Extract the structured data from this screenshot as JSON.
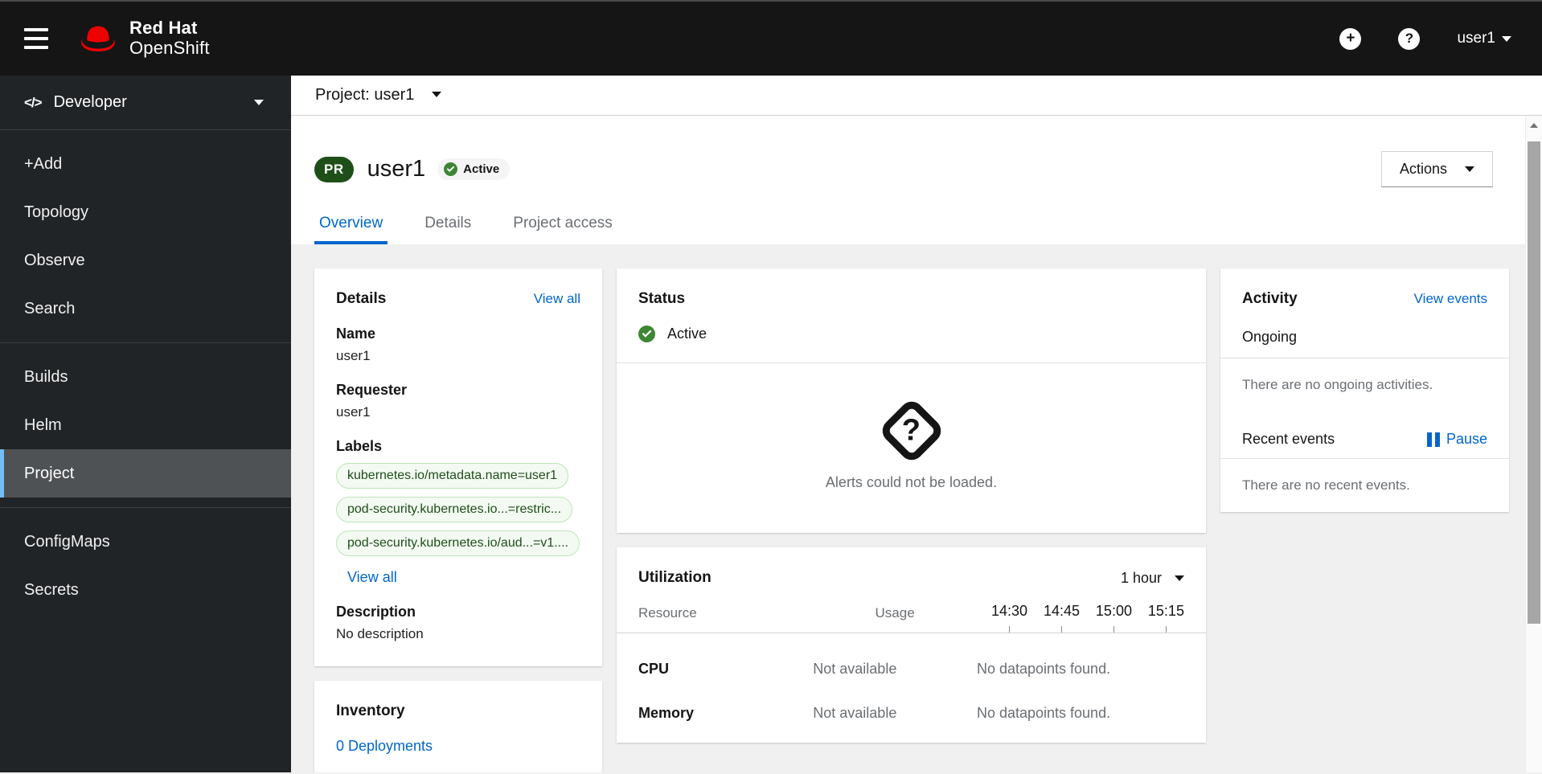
{
  "masthead": {
    "logo_line1": "Red Hat",
    "logo_line2": "OpenShift",
    "username": "user1"
  },
  "sidebar": {
    "perspective": {
      "label": "Developer"
    },
    "groups": [
      {
        "items": [
          {
            "label": "+Add"
          },
          {
            "label": "Topology"
          },
          {
            "label": "Observe"
          },
          {
            "label": "Search"
          }
        ]
      },
      {
        "items": [
          {
            "label": "Builds"
          },
          {
            "label": "Helm"
          },
          {
            "label": "Project"
          }
        ]
      },
      {
        "items": [
          {
            "label": "ConfigMaps"
          },
          {
            "label": "Secrets"
          }
        ]
      }
    ]
  },
  "project_bar": {
    "label": "Project: user1"
  },
  "page": {
    "badge": "PR",
    "title": "user1",
    "status_badge": "Active",
    "actions_label": "Actions",
    "tabs": [
      {
        "label": "Overview"
      },
      {
        "label": "Details"
      },
      {
        "label": "Project access"
      }
    ]
  },
  "details_card": {
    "title": "Details",
    "view_all": "View all",
    "fields": [
      {
        "label": "Name",
        "value": "user1"
      },
      {
        "label": "Requester",
        "value": "user1"
      }
    ],
    "labels_title": "Labels",
    "labels": [
      "kubernetes.io/metadata.name=user1",
      "pod-security.kubernetes.io...=restric...",
      "pod-security.kubernetes.io/aud...=v1...."
    ],
    "labels_view_all": "View all",
    "description_label": "Description",
    "description_value": "No description"
  },
  "inventory_card": {
    "title": "Inventory",
    "deployments_link": "0 Deployments"
  },
  "status_card": {
    "title": "Status",
    "status": "Active",
    "alerts_message": "Alerts could not be loaded."
  },
  "utilization_card": {
    "title": "Utilization",
    "duration": "1 hour",
    "resource_header": "Resource",
    "usage_header": "Usage",
    "times": [
      "14:30",
      "14:45",
      "15:00",
      "15:15"
    ],
    "rows": [
      {
        "resource": "CPU",
        "usage": "Not available",
        "graph": "No datapoints found."
      },
      {
        "resource": "Memory",
        "usage": "Not available",
        "graph": "No datapoints found."
      }
    ]
  },
  "activity_card": {
    "title": "Activity",
    "view_events": "View events",
    "ongoing_title": "Ongoing",
    "ongoing_empty": "There are no ongoing activities.",
    "recent_title": "Recent events",
    "pause_label": "Pause",
    "recent_empty": "There are no recent events."
  },
  "colors": {
    "accent": "#0066cc",
    "nav_active_accent": "#73bcf7",
    "success_green": "#3e8635",
    "project_badge_green": "#1e4f18",
    "masthead_bg": "#151515",
    "sidebar_bg": "#212427"
  }
}
